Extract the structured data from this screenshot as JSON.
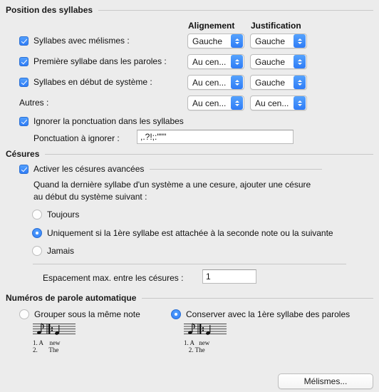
{
  "sections": {
    "position": {
      "title": "Position des syllabes",
      "column_headers": {
        "alignment": "Alignement",
        "justification": "Justification"
      },
      "rows": [
        {
          "label": "Syllabes avec mélismes :",
          "checkbox": "checked",
          "alignment": "Gauche",
          "justification": "Gauche"
        },
        {
          "label": "Première syllabe dans les paroles :",
          "checkbox": "checked",
          "alignment": "Au cen...",
          "justification": "Gauche"
        },
        {
          "label": "Syllabes en début de système :",
          "checkbox": "checked",
          "alignment": "Au cen...",
          "justification": "Gauche"
        },
        {
          "label": "Autres :",
          "checkbox": "none",
          "alignment": "Au cen...",
          "justification": "Au cen..."
        }
      ],
      "ignore_punctuation": {
        "label": "Ignorer la ponctuation dans les syllabes",
        "checked": true
      },
      "punctuation_field": {
        "label": "Ponctuation à ignorer :",
        "value": ",.?!;:\"\"''"
      }
    },
    "cesures": {
      "title": "Césures",
      "enable": {
        "label": "Activer les césures avancées",
        "checked": true
      },
      "description": "Quand la dernière syllabe d'un système a une cesure, ajouter une césure au début du système suivant :",
      "options": [
        {
          "label": "Toujours",
          "selected": false
        },
        {
          "label": "Uniquement si la 1ère syllabe est attachée à la seconde note ou la suivante",
          "selected": true
        },
        {
          "label": "Jamais",
          "selected": false
        }
      ],
      "spacing_field": {
        "label": "Espacement max. entre les césures :",
        "value": "1"
      }
    },
    "verse_numbers": {
      "title": "Numéros de parole automatique",
      "options": [
        {
          "label": "Grouper sous la même note",
          "selected": false,
          "lyric_line1": "1. A    new",
          "lyric_line2": "2.       The"
        },
        {
          "label": "Conserver avec la 1ère syllabe des paroles",
          "selected": true,
          "lyric_line1": "1. A   new",
          "lyric_line2": "   2. The"
        }
      ]
    }
  },
  "footer": {
    "melismes_button": "Mélismes..."
  },
  "colors": {
    "accent": "#2f7cf6",
    "window_background": "#ececec",
    "rule": "#c8c8c8"
  }
}
